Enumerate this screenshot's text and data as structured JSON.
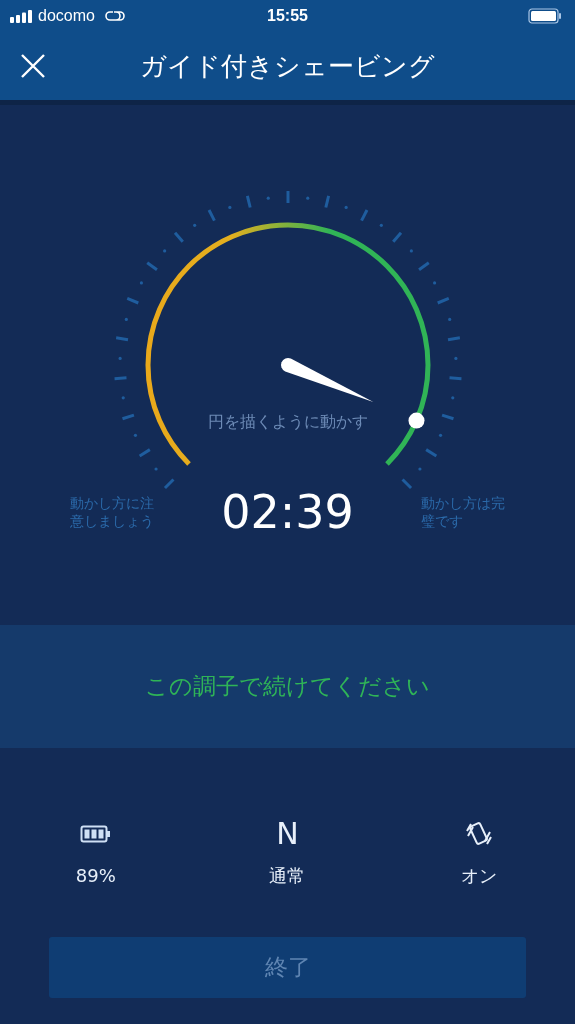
{
  "status_bar": {
    "carrier": "docomo",
    "time": "15:55"
  },
  "header": {
    "title": "ガイド付きシェービング"
  },
  "gauge": {
    "hint": "円を描くように動かす",
    "timer": "02:39",
    "left_label": "動かし方に注意しましょう",
    "right_label": "動かし方は完璧です"
  },
  "banner": {
    "message": "この調子で続けてください"
  },
  "stats": [
    {
      "kind": "battery",
      "label": "89%"
    },
    {
      "kind": "mode",
      "symbol": "N",
      "label": "通常"
    },
    {
      "kind": "vibration",
      "label": "オン"
    }
  ],
  "end_button": {
    "label": "終了"
  }
}
